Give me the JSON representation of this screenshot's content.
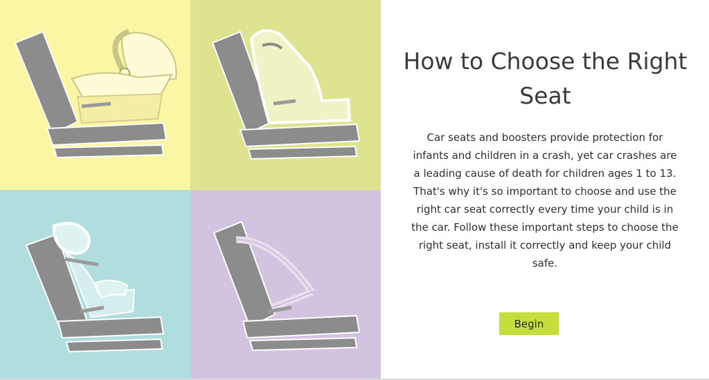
{
  "main": {
    "title": "How to Choose the Right Seat",
    "description": "Car seats and boosters provide protection for infants and children in a crash, yet car crashes are a leading cause of death for children ages 1 to 13. That's why it's so important to choose and use the right car seat correctly every time your child is in the car. Follow these important steps to choose the right seat, install it correctly and keep your child safe.",
    "begin_label": "Begin"
  },
  "tiles": [
    {
      "icon": "infant-car-seat-icon",
      "bg": "#fbf6a4"
    },
    {
      "icon": "convertible-car-seat-icon",
      "bg": "#dde38f"
    },
    {
      "icon": "booster-seat-icon",
      "bg": "#b0dedf"
    },
    {
      "icon": "seat-belt-icon",
      "bg": "#d2c3e0"
    }
  ],
  "colors": {
    "seat_gray": "#8c8c8c",
    "seat_outline": "#ffffff",
    "button_bg": "#c6dd3e"
  }
}
